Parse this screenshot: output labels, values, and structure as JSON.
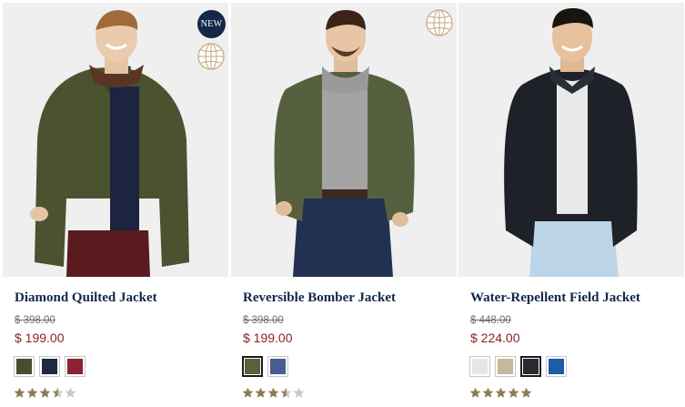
{
  "colors": {
    "title": "#13284a",
    "price": "#8c1f1f",
    "old_price": "#7a6868",
    "star_filled": "#8b7d4f",
    "star_empty": "#c8c8c8",
    "badge_bg": "#13284a",
    "globe": "#c4a97c"
  },
  "products": [
    {
      "name": "Diamond Quilted Jacket",
      "original_price": "$ 398.00",
      "sale_price": "$ 199.00",
      "badge": "NEW",
      "has_globe_icon": true,
      "jacket_color": "#4a5230",
      "swatches": [
        {
          "color": "#4a4c32",
          "selected": false
        },
        {
          "color": "#1e2746",
          "selected": false
        },
        {
          "color": "#8a2430",
          "selected": false
        }
      ],
      "rating": 3.5
    },
    {
      "name": "Reversible Bomber Jacket",
      "original_price": "$ 398.00",
      "sale_price": "$ 199.00",
      "badge": "",
      "has_globe_icon": true,
      "jacket_color": "#56603f",
      "swatches": [
        {
          "color": "#5a5f3c",
          "selected": true
        },
        {
          "color": "#4a5d8f",
          "selected": false
        }
      ],
      "rating": 3.5
    },
    {
      "name": "Water-Repellent Field Jacket",
      "original_price": "$ 448.00",
      "sale_price": "$ 224.00",
      "badge": "",
      "has_globe_icon": false,
      "jacket_color": "#1e2128",
      "swatches": [
        {
          "color": "#e6e6e6",
          "selected": false
        },
        {
          "color": "#c9b79a",
          "selected": false
        },
        {
          "color": "#262a33",
          "selected": true
        },
        {
          "color": "#1f5ca8",
          "selected": false
        }
      ],
      "rating": 5
    }
  ]
}
